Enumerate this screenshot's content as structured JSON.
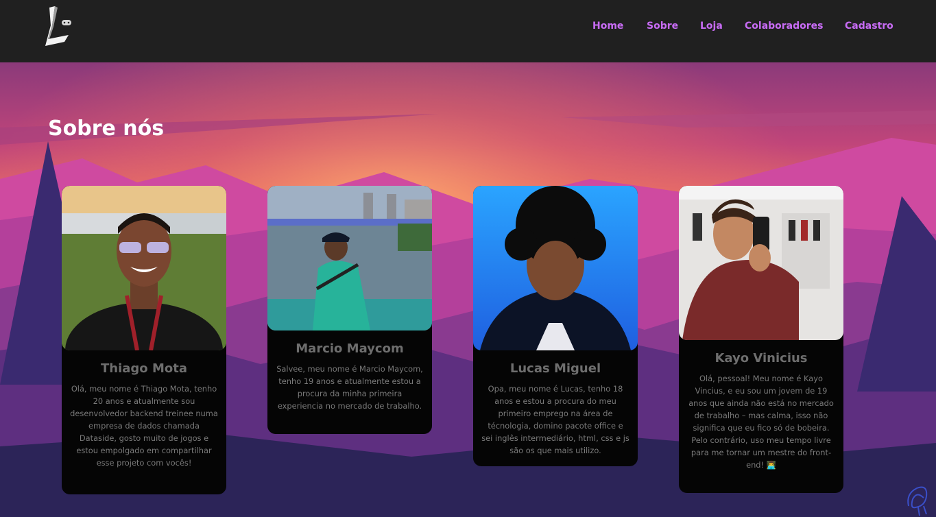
{
  "brand": {
    "logo_icon": "L-gamepad-logo-icon"
  },
  "nav": {
    "items": [
      "Home",
      "Sobre",
      "Loja",
      "Colaboradores",
      "Cadastro"
    ]
  },
  "colors": {
    "header_bg": "#202020",
    "nav_link": "#c86cf5",
    "card_bg": "#050505",
    "title": "#ffffff"
  },
  "about": {
    "title": "Sobre nós",
    "members": [
      {
        "name": "Thiago Mota",
        "description": "Olá, meu nome é Thiago Mota, tenho 20 anos e atualmente sou desenvolvedor backend treinee numa empresa de dados chamada Dataside, gosto muito de jogos e estou empolgado em compartilhar esse projeto com vocês!",
        "photo_icon": "portrait-photo-icon"
      },
      {
        "name": "Marcio Maycom",
        "description": "Salvee, meu nome é Marcio Maycom, tenho 19 anos e atualmente estou a procura da minha primeira experiencia no mercado de trabalho.",
        "photo_icon": "portrait-photo-icon"
      },
      {
        "name": "Lucas Miguel",
        "description": "Opa, meu nome é Lucas, tenho 18 anos e estou a procura do meu primeiro emprego na área de técnologia, domino pacote office e sei inglês intermediário, html, css e js são os que mais utilizo.",
        "photo_icon": "portrait-photo-icon"
      },
      {
        "name": "Kayo Vinicius",
        "description": "Olá, pessoal! Meu nome é Kayo Vincius, e eu sou um jovem de 19 anos que ainda não está no mercado de trabalho – mas calma, isso não significa que eu fico só de bobeira. Pelo contrário, uso meu tempo livre para me tornar um mestre do front-end! 👨‍💻",
        "photo_icon": "portrait-photo-icon"
      }
    ]
  },
  "corner_icon": "signature-icon"
}
